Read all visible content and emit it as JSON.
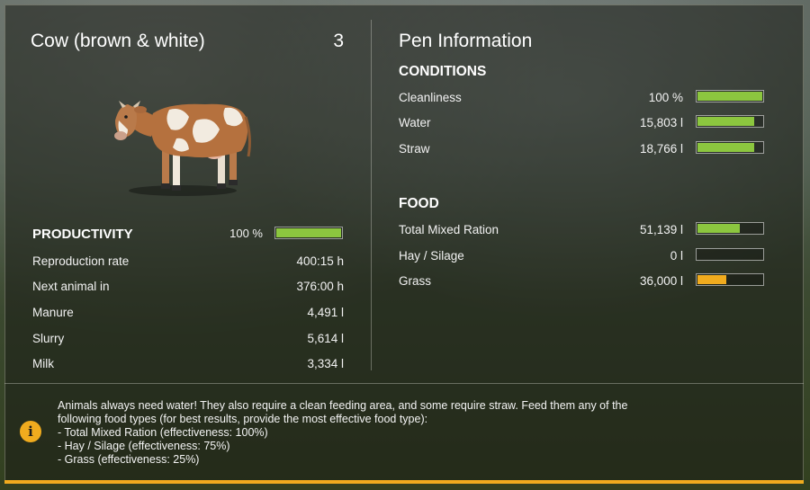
{
  "animal": {
    "title": "Cow (brown & white)",
    "count": "3"
  },
  "productivity": {
    "heading": "PRODUCTIVITY",
    "percent_label": "100 %",
    "level": 1.0,
    "bar_color": "#8cc63f",
    "stats": [
      {
        "label": "Reproduction rate",
        "value": "400:15 h"
      },
      {
        "label": "Next animal in",
        "value": "376:00 h"
      },
      {
        "label": "Manure",
        "value": "4,491 l"
      },
      {
        "label": "Slurry",
        "value": "5,614 l"
      },
      {
        "label": "Milk",
        "value": "3,334 l"
      }
    ]
  },
  "pen": {
    "title": "Pen Information",
    "conditions_heading": "CONDITIONS",
    "conditions": [
      {
        "label": "Cleanliness",
        "value": "100 %",
        "level": 1.0,
        "color": "#8cc63f"
      },
      {
        "label": "Water",
        "value": "15,803 l",
        "level": 0.88,
        "color": "#8cc63f"
      },
      {
        "label": "Straw",
        "value": "18,766 l",
        "level": 0.88,
        "color": "#8cc63f"
      }
    ],
    "food_heading": "FOOD",
    "food": [
      {
        "label": "Total Mixed Ration",
        "value": "51,139 l",
        "level": 0.65,
        "color": "#8cc63f"
      },
      {
        "label": "Hay / Silage",
        "value": "0 l",
        "level": 0.0,
        "color": "#8cc63f"
      },
      {
        "label": "Grass",
        "value": "36,000 l",
        "level": 0.45,
        "color": "#f0ab1e"
      }
    ]
  },
  "info": {
    "icon": "info-icon",
    "lines": [
      "Animals always need water! They also require a clean feeding area, and some require straw. Feed them any of the",
      "following food types (for best results, provide the most effective food type):",
      "- Total Mixed Ration (effectiveness: 100%)",
      "- Hay / Silage (effectiveness: 75%)",
      "- Grass (effectiveness: 25%)"
    ]
  },
  "accent_color": "#f0ab1e"
}
